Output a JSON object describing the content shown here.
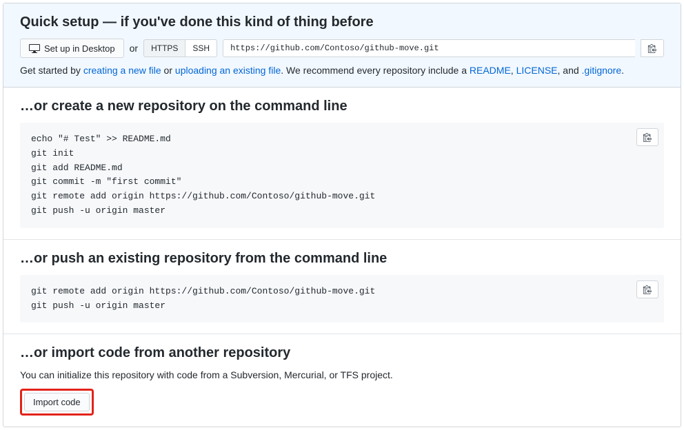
{
  "quick": {
    "title": "Quick setup — if you've done this kind of thing before",
    "desktop_btn": "Set up in Desktop",
    "or": "or",
    "https": "HTTPS",
    "ssh": "SSH",
    "url": "https://github.com/Contoso/github-move.git",
    "help_prefix": "Get started by ",
    "link_new": "creating a new file",
    "help_or": " or ",
    "link_upload": "uploading an existing file",
    "help_mid": ". We recommend every repository include a ",
    "link_readme": "README",
    "sep1": ", ",
    "link_license": "LICENSE",
    "sep2": ", and ",
    "link_gitignore": ".gitignore",
    "help_end": "."
  },
  "create": {
    "title": "…or create a new repository on the command line",
    "code": "echo \"# Test\" >> README.md\ngit init\ngit add README.md\ngit commit -m \"first commit\"\ngit remote add origin https://github.com/Contoso/github-move.git\ngit push -u origin master"
  },
  "push": {
    "title": "…or push an existing repository from the command line",
    "code": "git remote add origin https://github.com/Contoso/github-move.git\ngit push -u origin master"
  },
  "import": {
    "title": "…or import code from another repository",
    "desc": "You can initialize this repository with code from a Subversion, Mercurial, or TFS project.",
    "btn": "Import code"
  }
}
